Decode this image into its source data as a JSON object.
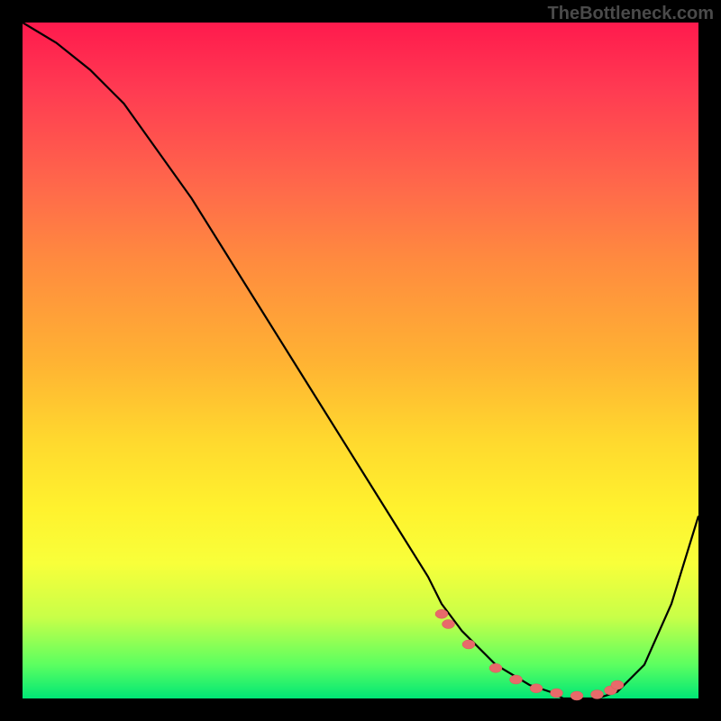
{
  "watermark": "TheBottleneck.com",
  "chart_data": {
    "type": "line",
    "title": "",
    "xlabel": "",
    "ylabel": "",
    "xlim": [
      0,
      100
    ],
    "ylim": [
      0,
      100
    ],
    "series": [
      {
        "name": "bottleneck-curve",
        "x": [
          0,
          5,
          10,
          15,
          20,
          25,
          30,
          35,
          40,
          45,
          50,
          55,
          60,
          62,
          65,
          70,
          75,
          78,
          80,
          82,
          85,
          88,
          92,
          96,
          100
        ],
        "y": [
          100,
          97,
          93,
          88,
          81,
          74,
          66,
          58,
          50,
          42,
          34,
          26,
          18,
          14,
          10,
          5,
          2,
          1,
          0,
          0,
          0,
          1,
          5,
          14,
          27
        ]
      }
    ],
    "points": {
      "name": "highlight-dots",
      "x": [
        62,
        63,
        66,
        70,
        73,
        76,
        79,
        82,
        85,
        87,
        88
      ],
      "y": [
        12.5,
        11,
        8,
        4.5,
        2.8,
        1.5,
        0.8,
        0.4,
        0.6,
        1.2,
        2
      ]
    }
  }
}
